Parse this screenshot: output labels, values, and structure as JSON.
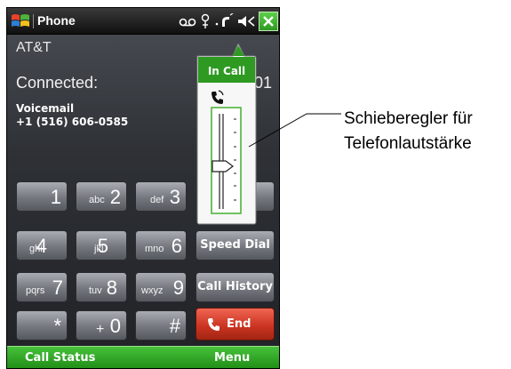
{
  "window": {
    "title": "Phone"
  },
  "status_icons": [
    "voicemail-icon",
    "antenna-icon",
    "call-signal-icon",
    "speaker-muted-icon",
    "close-icon"
  ],
  "call": {
    "carrier": "AT&T",
    "state": "Connected:",
    "timer_fragment": "01",
    "voicemail_label": "Voicemail",
    "voicemail_number": "+1 (516) 606-0585"
  },
  "keypad": {
    "keys": [
      {
        "sub": "",
        "main": "1"
      },
      {
        "sub": "abc",
        "main": "2"
      },
      {
        "sub": "def",
        "main": "3"
      },
      {
        "sub": "ghi",
        "main": "4"
      },
      {
        "sub": "jkl",
        "main": "5"
      },
      {
        "sub": "mno",
        "main": "6"
      },
      {
        "sub": "pqrs",
        "main": "7"
      },
      {
        "sub": "tuv",
        "main": "8"
      },
      {
        "sub": "wxyz",
        "main": "9"
      },
      {
        "sub": "",
        "main": "*"
      },
      {
        "sub": "+",
        "main": "0"
      },
      {
        "sub": "",
        "main": "#"
      }
    ],
    "speed_dial": "Speed Dial",
    "call_history": "Call History",
    "end": "End"
  },
  "volume_popup": {
    "title": "In Call",
    "icon": "phone-volume-icon",
    "level_fraction": 0.45
  },
  "softkeys": {
    "left": "Call Status",
    "right": "Menu"
  },
  "callout": {
    "line1": "Schieberegler für",
    "line2": "Telefonlautstärke"
  },
  "colors": {
    "accent_green": "#2e9a22",
    "end_red": "#c8321f"
  }
}
